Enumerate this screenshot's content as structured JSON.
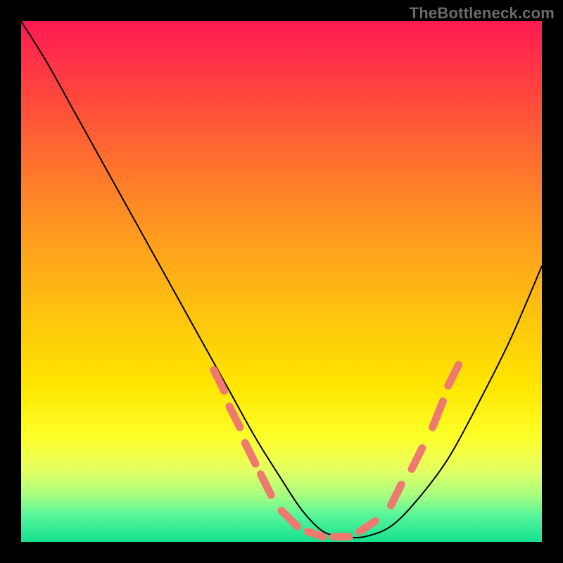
{
  "watermark": "TheBottleneck.com",
  "colors": {
    "gradient_top": "#ff1a52",
    "gradient_bottom": "#16e08e",
    "curve": "#000000",
    "dash": "#ee7a6f",
    "frame_bg": "#000000"
  },
  "chart_data": {
    "type": "line",
    "title": "",
    "xlabel": "",
    "ylabel": "",
    "xlim": [
      0,
      100
    ],
    "ylim": [
      0,
      100
    ],
    "grid": false,
    "legend": false,
    "note": "Bottleneck curve; background hue encodes bottleneck severity (red=high, green=low). Curve is schematic — no numeric axis ticks are shown in the source image, so x/y values below are approximate percent of plot area.",
    "series": [
      {
        "name": "bottleneck-curve",
        "x": [
          0,
          5,
          10,
          15,
          20,
          25,
          30,
          35,
          40,
          45,
          50,
          54,
          58,
          62,
          66,
          71,
          76,
          82,
          88,
          94,
          100
        ],
        "y": [
          100,
          92,
          83,
          74,
          65,
          56,
          47,
          38,
          29,
          20,
          12,
          6,
          2,
          1,
          1,
          3,
          8,
          16,
          27,
          39,
          53
        ]
      }
    ],
    "highlight_dashes": {
      "description": "short coral dashes overlaid on both flanks near the valley and along the trough",
      "segments": [
        {
          "x0": 37,
          "y0": 33,
          "x1": 39,
          "y1": 29
        },
        {
          "x0": 40,
          "y0": 26,
          "x1": 42,
          "y1": 22
        },
        {
          "x0": 43,
          "y0": 19,
          "x1": 45,
          "y1": 15
        },
        {
          "x0": 46,
          "y0": 13,
          "x1": 48,
          "y1": 9
        },
        {
          "x0": 50,
          "y0": 6,
          "x1": 53,
          "y1": 3
        },
        {
          "x0": 55,
          "y0": 2,
          "x1": 58,
          "y1": 1
        },
        {
          "x0": 60,
          "y0": 1,
          "x1": 63,
          "y1": 1
        },
        {
          "x0": 65,
          "y0": 2,
          "x1": 68,
          "y1": 4
        },
        {
          "x0": 71,
          "y0": 7,
          "x1": 73,
          "y1": 11
        },
        {
          "x0": 75,
          "y0": 14,
          "x1": 77,
          "y1": 18
        },
        {
          "x0": 79,
          "y0": 22,
          "x1": 81,
          "y1": 27
        },
        {
          "x0": 82,
          "y0": 30,
          "x1": 84,
          "y1": 34
        }
      ]
    }
  }
}
